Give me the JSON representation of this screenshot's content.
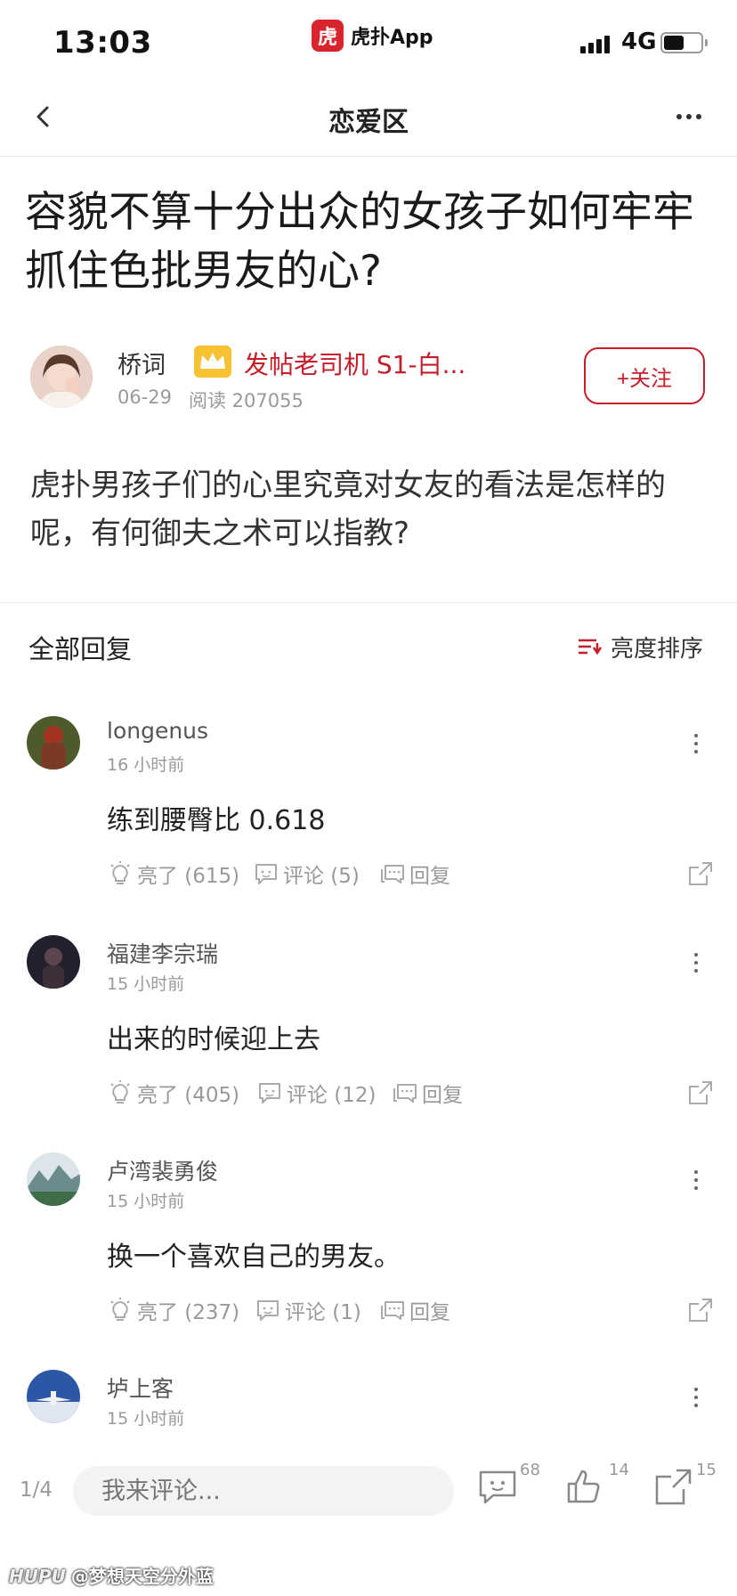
{
  "status_bar": {
    "time": "13:03",
    "app_logo_text": "虎",
    "app_name": "虎扑App",
    "network": "4G",
    "battery_level": 0.5
  },
  "nav": {
    "title": "恋爱区"
  },
  "post": {
    "title": "容貌不算十分出众的女孩子如何牢牢抓住色批男友的心?",
    "author": "桥词",
    "badge": "发帖老司机 S1-白...",
    "date": "06-29",
    "reads": "阅读 207055",
    "follow_label": "+关注",
    "body": "虎扑男孩子们的心里究竟对女友的看法是怎样的呢，有何御夫之术可以指教?"
  },
  "replies_header": {
    "title": "全部回复",
    "sort_label": "亮度排序"
  },
  "replies": [
    {
      "username": "longenus",
      "time": "16 小时前",
      "content": "练到腰臀比 0.618",
      "likes": "亮了 (615)",
      "comments": "评论 (5)",
      "reply": "回复",
      "avatar_color": "#6d4a2e"
    },
    {
      "username": "福建李宗瑞",
      "time": "15 小时前",
      "content": "出来的时候迎上去",
      "likes": "亮了 (405)",
      "comments": "评论 (12)",
      "reply": "回复",
      "avatar_color": "#2a2535"
    },
    {
      "username": "卢湾裴勇俊",
      "time": "15 小时前",
      "content": "换一个喜欢自己的男友。",
      "likes": "亮了 (237)",
      "comments": "评论 (1)",
      "reply": "回复",
      "avatar_color": "#6e8e78"
    },
    {
      "username": "垆上客",
      "time": "15 小时前",
      "content": "",
      "likes": "",
      "comments": "",
      "reply": "",
      "avatar_color": "#2c4e8c"
    }
  ],
  "bottom_bar": {
    "page": "1/4",
    "comment_placeholder": "我来评论...",
    "comment_count": "68",
    "like_count": "14",
    "share_count": "15"
  },
  "watermark": {
    "logo": "HUPU",
    "text": "@梦想天空分外蓝"
  },
  "colors": {
    "accent": "#c41e2b",
    "brand": "#d8252d",
    "muted": "#999999"
  }
}
